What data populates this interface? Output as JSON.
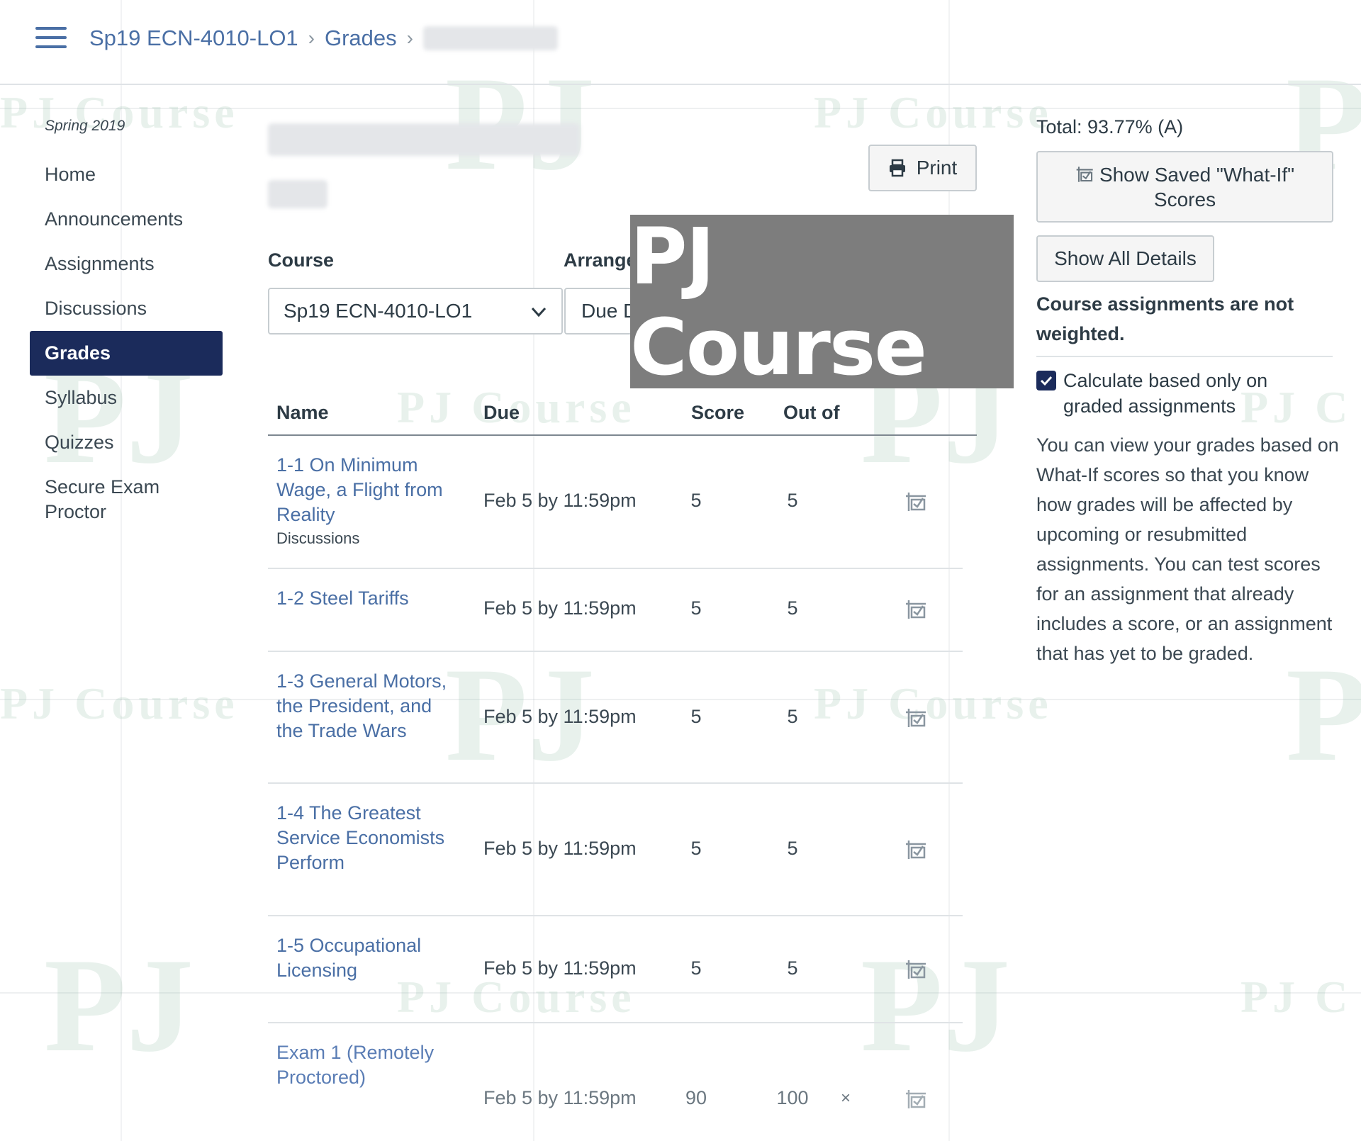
{
  "breadcrumb": {
    "course": "Sp19 ECN-4010-LO1",
    "section": "Grades"
  },
  "sidebar": {
    "term": "Spring 2019",
    "items": [
      {
        "label": "Home"
      },
      {
        "label": "Announcements"
      },
      {
        "label": "Assignments"
      },
      {
        "label": "Discussions"
      },
      {
        "label": "Grades",
        "active": true
      },
      {
        "label": "Syllabus"
      },
      {
        "label": "Quizzes"
      },
      {
        "label": "Secure Exam Proctor"
      }
    ]
  },
  "toolbar": {
    "print_label": "Print",
    "print_icon": "printer-icon"
  },
  "filters": {
    "course_label": "Course",
    "course_value": "Sp19 ECN-4010-LO1",
    "arrange_label": "Arrange",
    "arrange_value": "Due D"
  },
  "overlay": {
    "text": "PJ Course"
  },
  "table": {
    "headers": {
      "name": "Name",
      "due": "Due",
      "score": "Score",
      "out_of": "Out of"
    },
    "rows": [
      {
        "name": "1-1 On Minimum Wage, a Flight from Reality",
        "category": "Discussions",
        "due": "Feb 5 by 11:59pm",
        "score": "5",
        "out_of": "5",
        "icon": "what-if-icon"
      },
      {
        "name": "1-2 Steel Tariffs",
        "category": "",
        "due": "Feb 5 by 11:59pm",
        "score": "5",
        "out_of": "5",
        "icon": "what-if-icon"
      },
      {
        "name": "1-3 General Motors, the President, and the Trade Wars",
        "category": "",
        "due": "Feb 5 by 11:59pm",
        "score": "5",
        "out_of": "5",
        "icon": "what-if-icon"
      },
      {
        "name": "1-4 The Greatest Service Economists Perform",
        "category": "",
        "due": "Feb 5 by 11:59pm",
        "score": "5",
        "out_of": "5",
        "icon": "what-if-icon"
      },
      {
        "name": "1-5 Occupational Licensing",
        "category": "",
        "due": "Feb 5 by 11:59pm",
        "score": "5",
        "out_of": "5",
        "icon": "what-if-icon"
      },
      {
        "name": "Exam 1 (Remotely Proctored)",
        "category": "",
        "due": "Feb 5 by 11:59pm",
        "score": "90",
        "out_of": "100",
        "mark": "×",
        "icon": "what-if-icon"
      }
    ]
  },
  "right_panel": {
    "total": "Total: 93.77% (A)",
    "show_saved_label": "Show Saved \"What-If\" Scores",
    "show_all_label": "Show All Details",
    "weighted_note": "Course assignments are not weighted.",
    "checkbox_label": "Calculate based only on graded assignments",
    "checkbox_checked": true,
    "info_text": "You can view your grades based on What-If scores so that you know how grades will be affected by upcoming or resubmitted assignments. You can test scores for an assignment that already includes a score, or an assignment that has yet to be graded."
  },
  "watermark": {
    "text": "PJ Course",
    "short": "PJ",
    "p": "P",
    "partial": "PJ C"
  },
  "colors": {
    "accent": "#4a6fa5",
    "nav_active_bg": "#1b2b5b",
    "overlay_bg": "#7d7d7d"
  }
}
